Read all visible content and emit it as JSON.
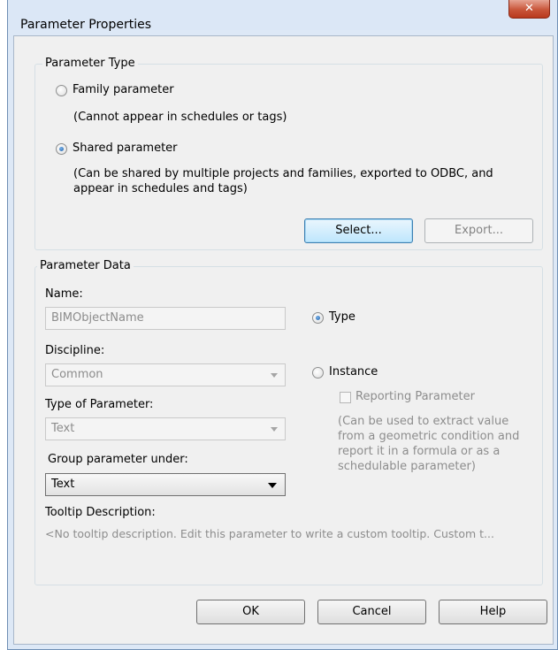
{
  "window": {
    "title": "Parameter Properties",
    "close_glyph": "✕"
  },
  "parameter_type": {
    "legend": "Parameter Type",
    "family": {
      "label": "Family parameter",
      "note": "(Cannot appear in schedules or tags)",
      "selected": false
    },
    "shared": {
      "label": "Shared parameter",
      "note_line1": "(Can be shared by multiple projects and families, exported to ODBC, and",
      "note_line2": "appear in schedules and tags)",
      "selected": true
    },
    "select_label": "Select...",
    "export_label": "Export..."
  },
  "parameter_data": {
    "legend": "Parameter Data",
    "name_label": "Name:",
    "name_value": "BIMObjectName",
    "discipline_label": "Discipline:",
    "discipline_value": "Common",
    "type_of_parameter_label": "Type of Parameter:",
    "type_of_parameter_value": "Text",
    "group_label": "Group parameter under:",
    "group_value": "Text",
    "tooltip_label": "Tooltip Description:",
    "tooltip_text": "<No tooltip description. Edit this parameter to write a custom tooltip. Custom t...",
    "type_radio": {
      "label": "Type",
      "selected": true
    },
    "instance_radio": {
      "label": "Instance",
      "selected": false
    },
    "reporting_label": "Reporting Parameter",
    "reporting_note_line1": "(Can be used to extract value",
    "reporting_note_line2": "from a geometric condition and",
    "reporting_note_line3": "report it in a formula or as a",
    "reporting_note_line4": "schedulable parameter)"
  },
  "footer": {
    "ok_label": "OK",
    "cancel_label": "Cancel",
    "help_label": "Help"
  },
  "colors": {
    "title_bar": "#dbe7f6",
    "close_button": "#c9553a",
    "dialog_bg": "#f0f0f0",
    "focus_button": "#bee6fd"
  }
}
